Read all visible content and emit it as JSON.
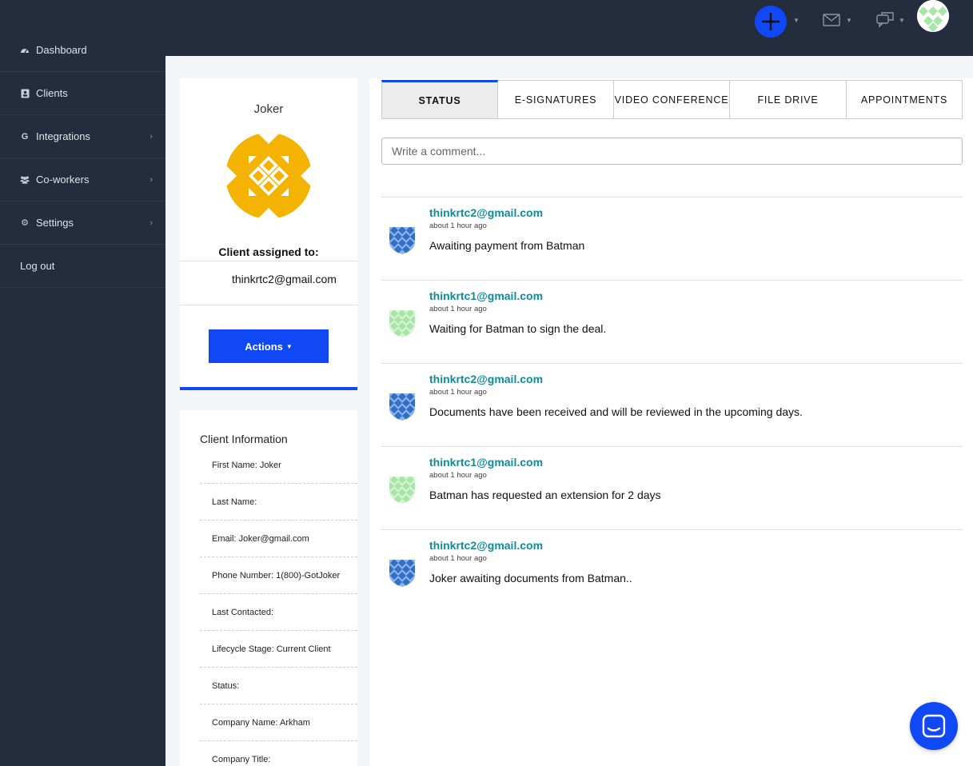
{
  "sidebar": {
    "items": [
      {
        "label": "Dashboard",
        "icon": "dashboard-icon"
      },
      {
        "label": "Clients",
        "icon": "clients-icon"
      },
      {
        "label": "Integrations",
        "icon": "google-icon"
      },
      {
        "label": "Co-workers",
        "icon": "users-icon"
      },
      {
        "label": "Settings",
        "icon": "gear-icon"
      },
      {
        "label": "Log out",
        "icon": ""
      }
    ]
  },
  "topbar": {
    "icons": [
      "plus-icon",
      "mail-icon",
      "chat-icon",
      "avatar"
    ]
  },
  "profile": {
    "name": "Joker",
    "assigned_label": "Client assigned to:",
    "assigned_email": "thinkrtc2@gmail.com",
    "actions_label": "Actions"
  },
  "client_info": {
    "title": "Client Information",
    "rows": [
      "First Name: Joker",
      "Last Name:",
      "Email: Joker@gmail.com",
      "Phone Number: 1(800)-GotJoker",
      "Last Contacted:",
      "Lifecycle Stage: Current Client",
      "Status:",
      "Company Name: Arkham",
      "Company Title:"
    ]
  },
  "tabs": [
    "STATUS",
    "E-SIGNATURES",
    "VIDEO CONFERENCE",
    "FILE DRIVE",
    "APPOINTMENTS"
  ],
  "comment": {
    "placeholder": "Write a comment..."
  },
  "feed": [
    {
      "email": "thinkrtc2@gmail.com",
      "time": "about 1 hour ago",
      "text": "Awaiting payment from Batman",
      "avatar": "blue"
    },
    {
      "email": "thinkrtc1@gmail.com",
      "time": "about 1 hour ago",
      "text": "Waiting for Batman to sign the deal.",
      "avatar": "green"
    },
    {
      "email": "thinkrtc2@gmail.com",
      "time": "about 1 hour ago",
      "text": "Documents have been received and will be reviewed in the upcoming days.",
      "avatar": "blue"
    },
    {
      "email": "thinkrtc1@gmail.com",
      "time": "about 1 hour ago",
      "text": "Batman has requested an extension for 2 days",
      "avatar": "green"
    },
    {
      "email": "thinkrtc2@gmail.com",
      "time": "about 1 hour ago",
      "text": "Joker awaiting documents from Batman..",
      "avatar": "blue"
    }
  ],
  "colors": {
    "sidebar_bg": "#232d3d",
    "accent": "#1048f5",
    "link": "#128a9c",
    "logo_yellow": "#f5b301"
  }
}
